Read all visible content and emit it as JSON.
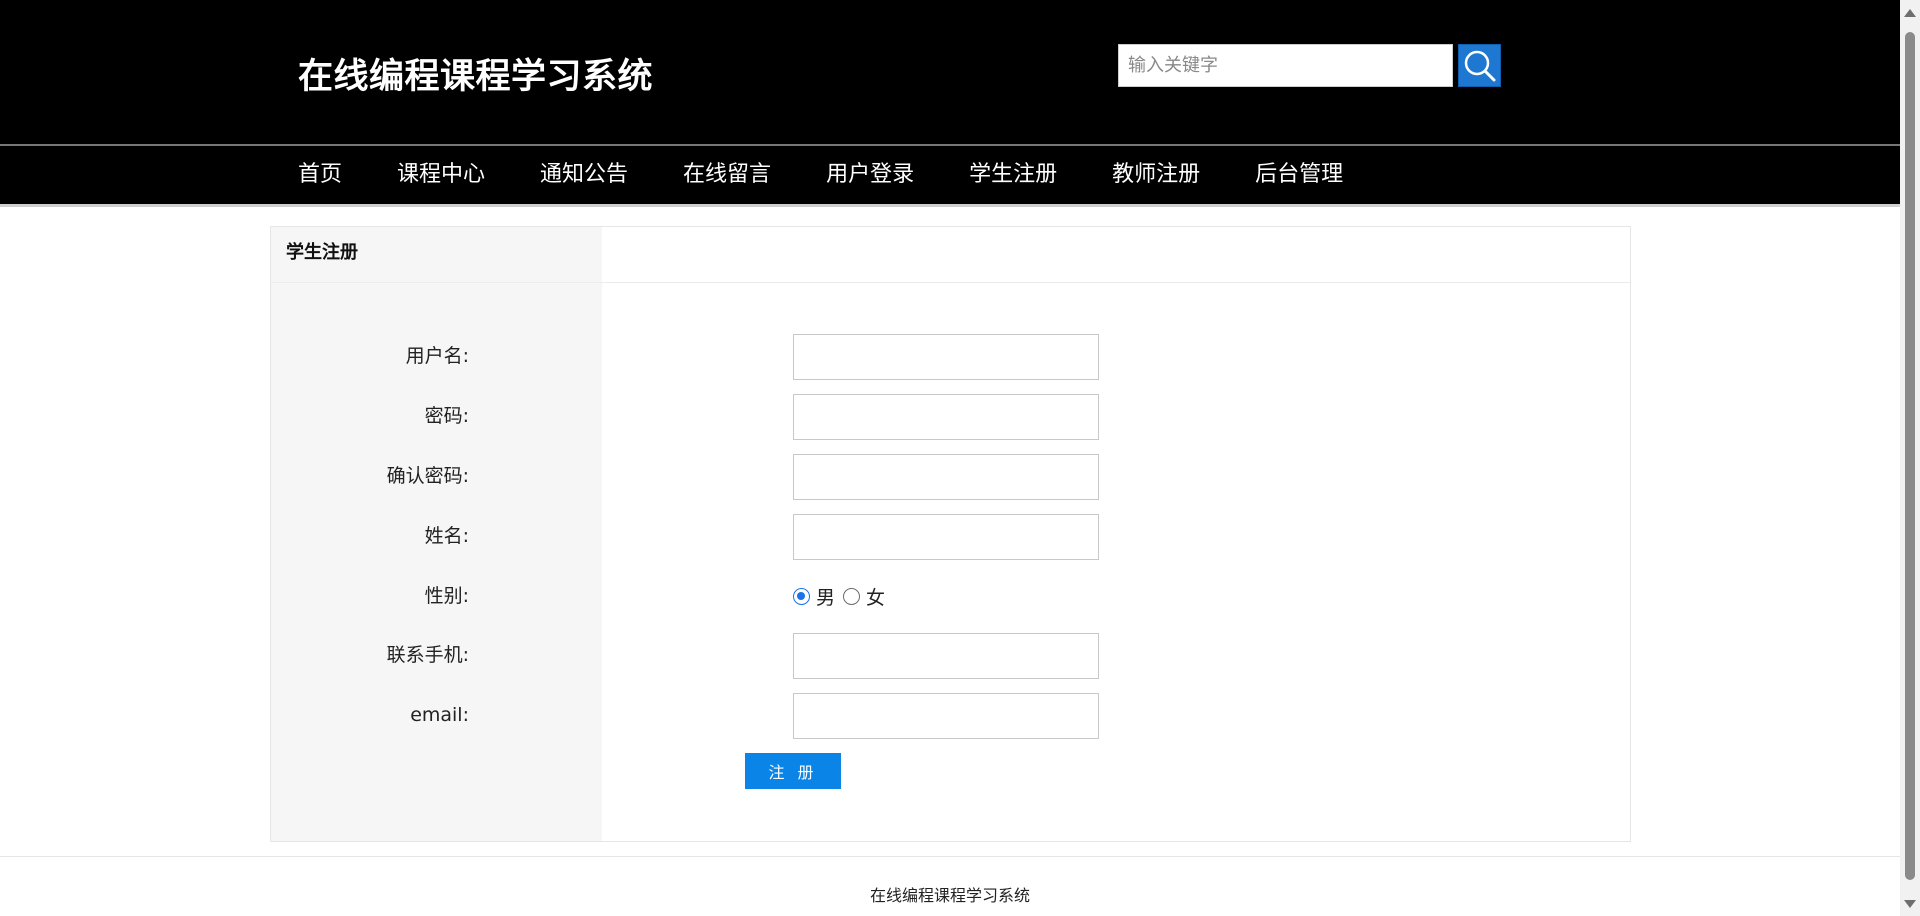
{
  "header": {
    "title": "在线编程课程学习系统",
    "search_placeholder": "输入关键字",
    "search_icon": "search-icon"
  },
  "nav": {
    "items": [
      {
        "label": "首页"
      },
      {
        "label": "课程中心"
      },
      {
        "label": "通知公告"
      },
      {
        "label": "在线留言"
      },
      {
        "label": "用户登录"
      },
      {
        "label": "学生注册"
      },
      {
        "label": "教师注册"
      },
      {
        "label": "后台管理"
      }
    ]
  },
  "panel": {
    "title": "学生注册"
  },
  "form": {
    "username_label": "用户名:",
    "password_label": "密码:",
    "confirm_password_label": "确认密码:",
    "name_label": "姓名:",
    "gender_label": "性别:",
    "gender_options": [
      {
        "label": "男",
        "selected": true
      },
      {
        "label": "女",
        "selected": false
      }
    ],
    "phone_label": "联系手机:",
    "email_label": "email:",
    "submit_label": "注 册"
  },
  "footer": {
    "text": "在线编程课程学习系统"
  },
  "colors": {
    "header_bg": "#000000",
    "search_button": "#1e78d2",
    "submit_button": "#0a84e6",
    "panel_left_bg": "#f6f6f6"
  }
}
